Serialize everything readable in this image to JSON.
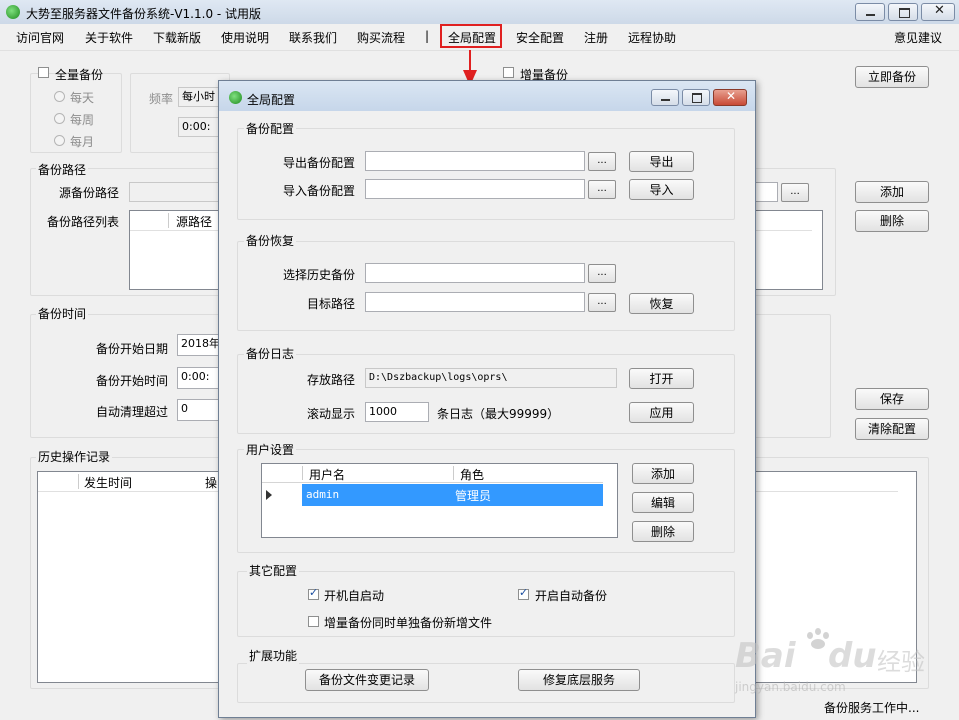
{
  "window": {
    "title": "大势至服务器文件备份系统-V1.1.0 - 试用版"
  },
  "menu": {
    "items": [
      "访问官网",
      "关于软件",
      "下载新版",
      "使用说明",
      "联系我们",
      "购买流程"
    ],
    "separator": "|",
    "global_config": "全局配置",
    "security_config": "安全配置",
    "register": "注册",
    "remote_assist": "远程协助",
    "feedback": "意见建议"
  },
  "main": {
    "full_backup": "全量备份",
    "daily": "每天",
    "weekly": "每周",
    "monthly": "每月",
    "frequency_label": "频率",
    "frequency_value": "每小时",
    "time_value": "0:00:",
    "incremental_backup": "增量备份",
    "backup_now": "立即备份",
    "backup_path_title": "备份路径",
    "source_path_label": "源备份路径",
    "path_list_label": "备份路径列表",
    "source_path_col": "源路径",
    "add": "添加",
    "delete": "删除",
    "backup_time_title": "备份时间",
    "start_date_label": "备份开始日期",
    "start_date_value": "2018年",
    "start_time_label": "备份开始时间",
    "start_time_value": "0:00:",
    "auto_clean_label": "自动清理超过",
    "auto_clean_value": "0",
    "save": "保存",
    "clear_config": "清除配置",
    "history_title": "历史操作记录",
    "history_col_time": "发生时间",
    "history_col_op": "操",
    "status": "备份服务工作中..."
  },
  "dialog": {
    "title": "全局配置",
    "backup_config": {
      "title": "备份配置",
      "export_label": "导出备份配置",
      "import_label": "导入备份配置",
      "browse": "...",
      "export_btn": "导出",
      "import_btn": "导入"
    },
    "restore": {
      "title": "备份恢复",
      "history_label": "选择历史备份",
      "target_label": "目标路径",
      "restore_btn": "恢复"
    },
    "log": {
      "title": "备份日志",
      "path_label": "存放路径",
      "path_value": "D:\\Dszbackup\\logs\\oprs\\",
      "open_btn": "打开",
      "scroll_label": "滚动显示",
      "scroll_value": "1000",
      "scroll_suffix": "条日志（最大99999）",
      "apply_btn": "应用"
    },
    "users": {
      "title": "用户设置",
      "col_username": "用户名",
      "col_role": "角色",
      "rows": [
        {
          "username": "admin",
          "role": "管理员"
        }
      ],
      "add_btn": "添加",
      "edit_btn": "编辑",
      "delete_btn": "删除"
    },
    "other": {
      "title": "其它配置",
      "autostart": "开机自启动",
      "auto_backup": "开启自动备份",
      "separate_new_files": "增量备份同时单独备份新增文件"
    },
    "extend": {
      "title": "扩展功能",
      "change_log_btn": "备份文件变更记录",
      "repair_btn": "修复底层服务"
    }
  },
  "watermark": {
    "brand": "Bai",
    "brand2": "du",
    "cn": "经验",
    "url": "jingyan.baidu.com"
  },
  "colors": {
    "highlight_red": "#e02020",
    "selection_blue": "#3399ff",
    "title_blue": "#cfdcec"
  }
}
